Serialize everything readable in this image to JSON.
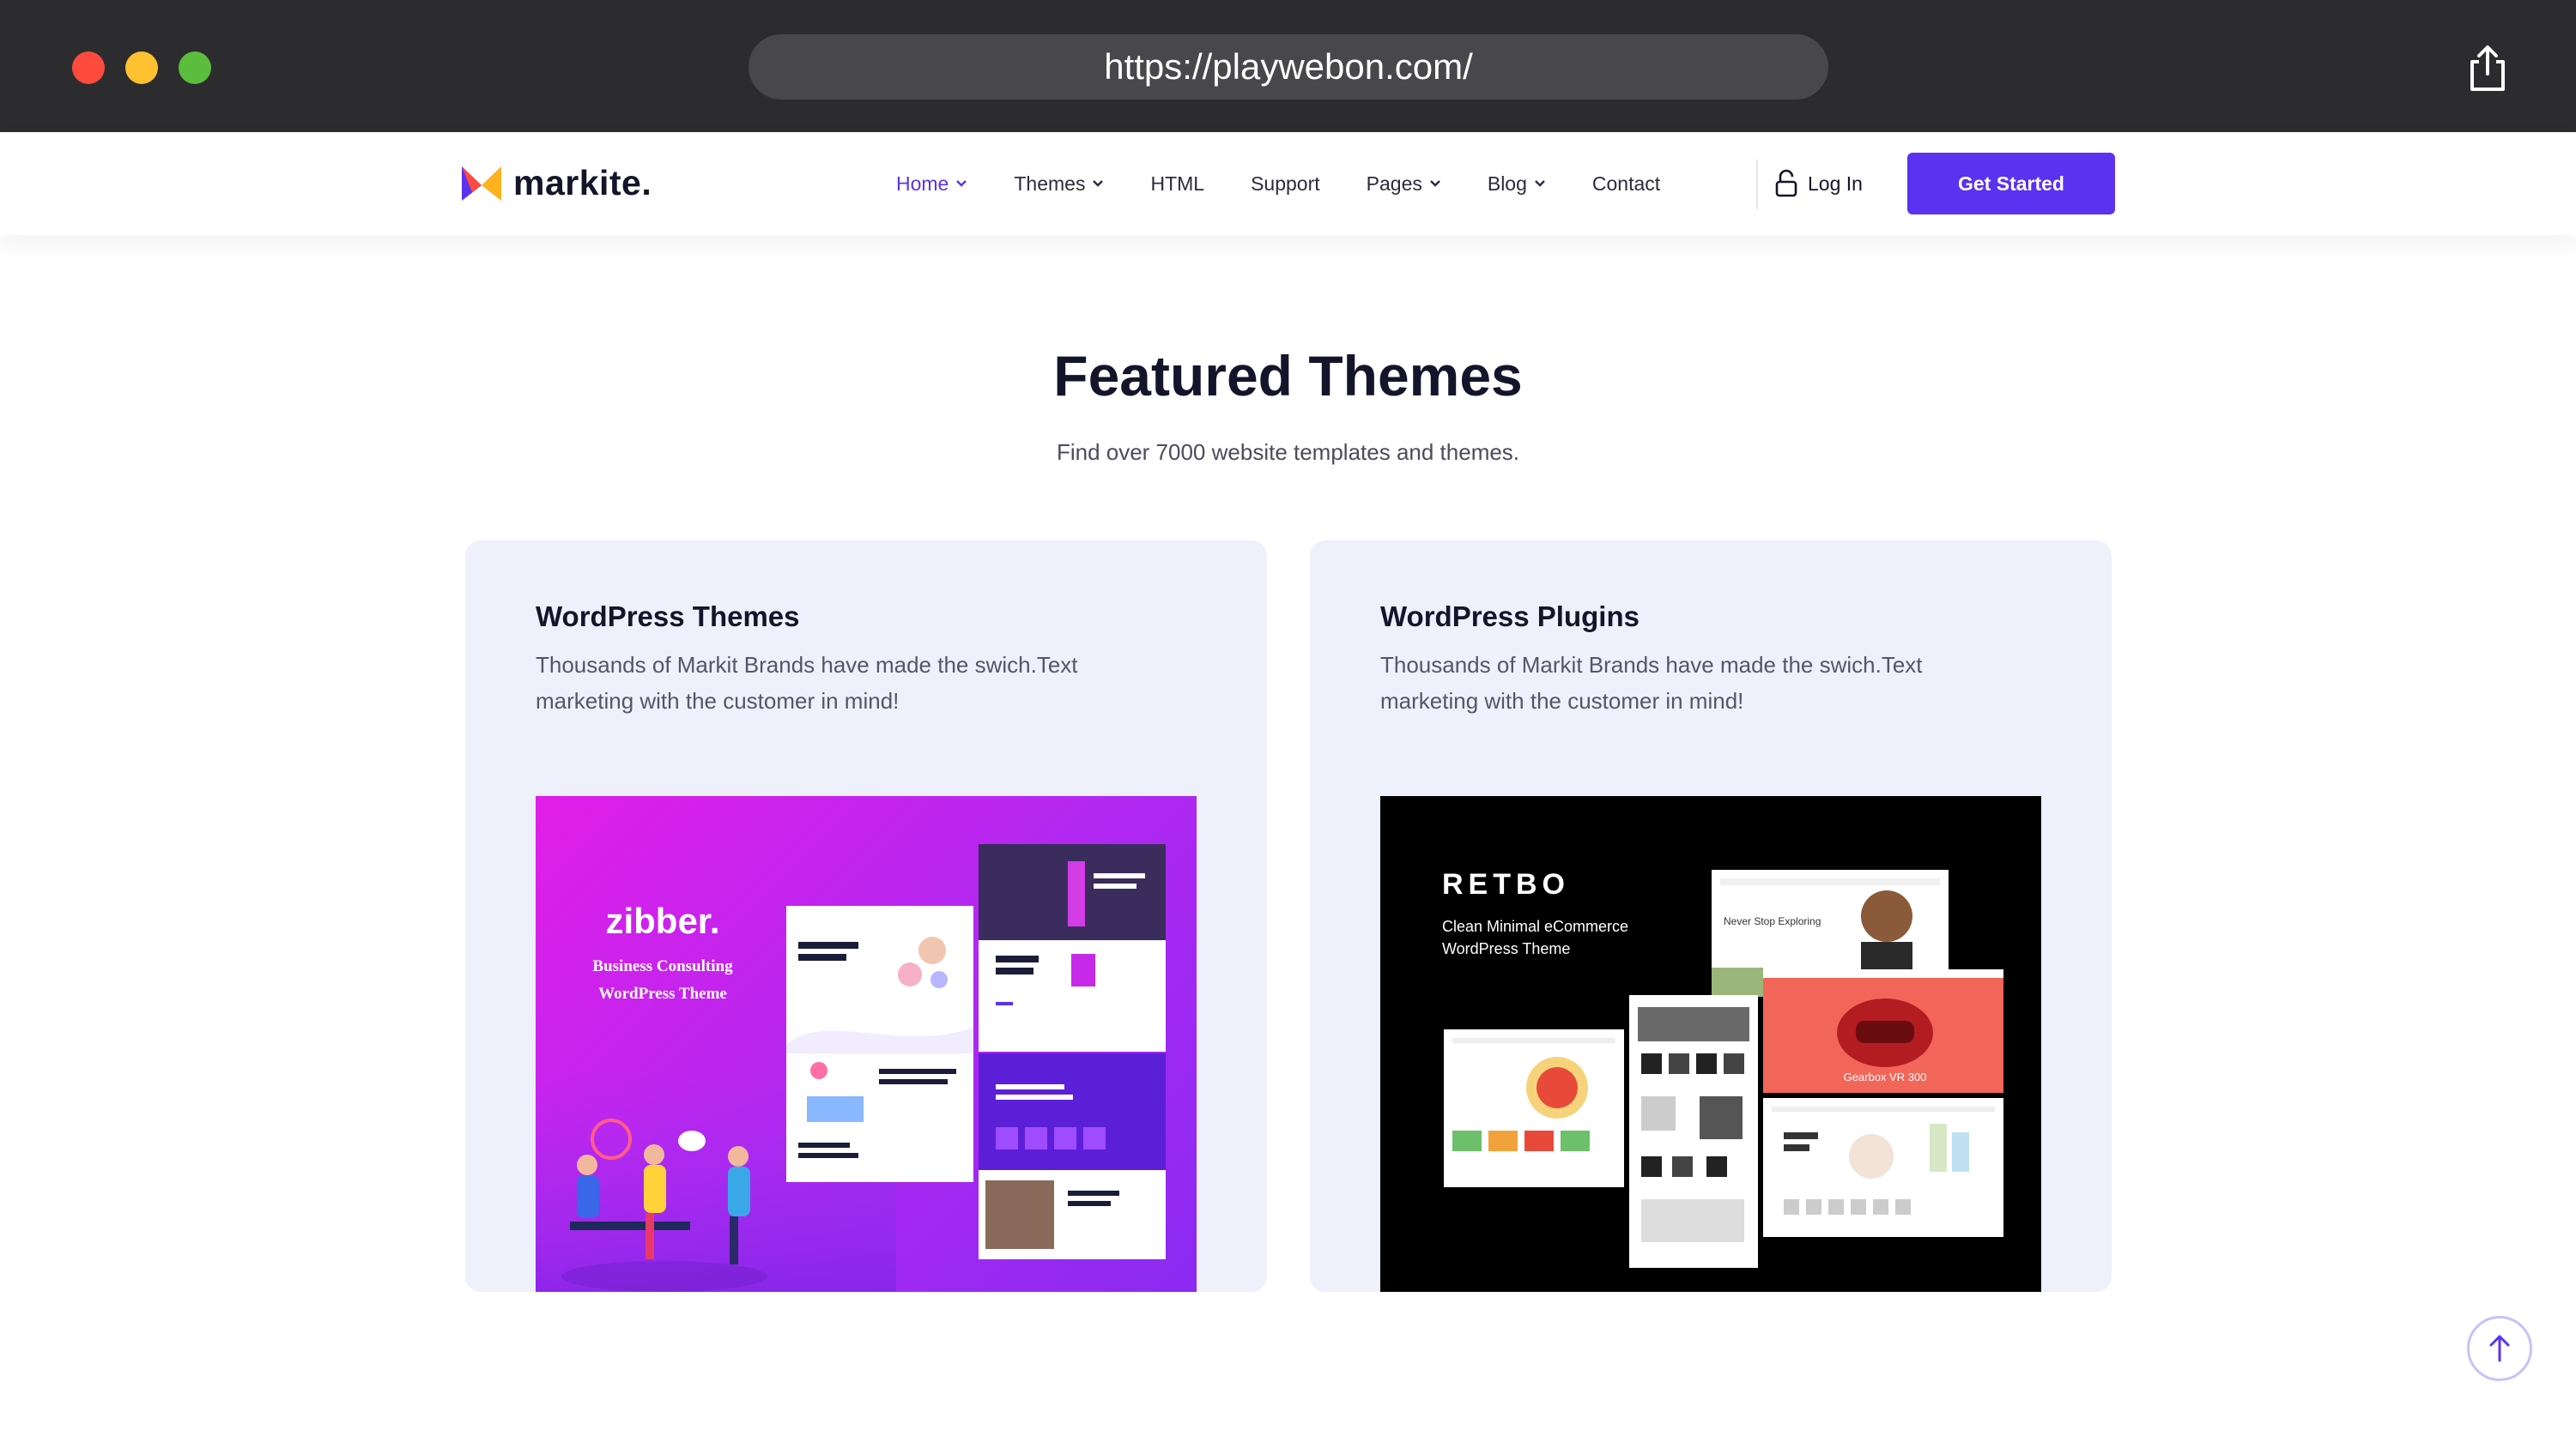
{
  "browser": {
    "url": "https://playwebon.com/"
  },
  "nav": {
    "logo_text": "markite.",
    "items": [
      {
        "label": "Home",
        "has_dropdown": true,
        "active": true
      },
      {
        "label": "Themes",
        "has_dropdown": true,
        "active": false
      },
      {
        "label": "HTML",
        "has_dropdown": false,
        "active": false
      },
      {
        "label": "Support",
        "has_dropdown": false,
        "active": false
      },
      {
        "label": "Pages",
        "has_dropdown": true,
        "active": false
      },
      {
        "label": "Blog",
        "has_dropdown": true,
        "active": false
      },
      {
        "label": "Contact",
        "has_dropdown": false,
        "active": false
      }
    ],
    "login_label": "Log In",
    "cta_label": "Get Started"
  },
  "section": {
    "title": "Featured Themes",
    "subtitle": "Find over 7000 website templates and themes."
  },
  "cards": [
    {
      "title": "WordPress Themes",
      "description": "Thousands of Markit Brands have made the swich.Text marketing with the customer in mind!",
      "preview": {
        "brand": "zibber.",
        "tagline_1": "Business Consulting",
        "tagline_2": "WordPress Theme"
      }
    },
    {
      "title": "WordPress Plugins",
      "description": "Thousands of Markit Brands have made the swich.Text marketing with the customer in mind!",
      "preview": {
        "brand": "RETBO",
        "tagline_1": "Clean Minimal eCommerce",
        "tagline_2": "WordPress Theme",
        "mock_1": "Never Stop Exploring",
        "mock_2": "Gearbox VR 300"
      }
    }
  ],
  "colors": {
    "accent": "#5a32f0",
    "chrome": "#2c2c2e",
    "card_bg": "#eef0fb"
  }
}
